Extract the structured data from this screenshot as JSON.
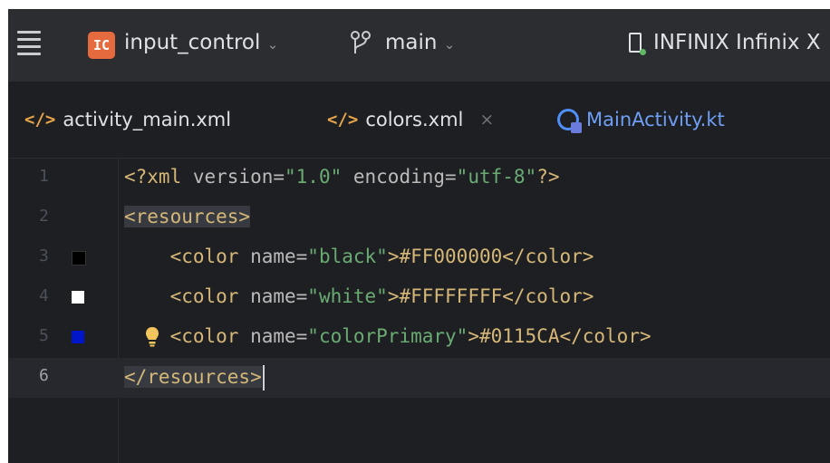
{
  "toolbar": {
    "project_badge": "IC",
    "project_name": "input_control",
    "branch_name": "main",
    "device_name": "INFINIX Infinix X",
    "chevron": "⌄"
  },
  "tabs": [
    {
      "label": "activity_main.xml",
      "icon": "xml-icon",
      "active": false
    },
    {
      "label": "colors.xml",
      "icon": "xml-icon",
      "active": true,
      "close": "×"
    },
    {
      "label": "MainActivity.kt",
      "icon": "kotlin-class-icon",
      "active": false
    }
  ],
  "xml_icon_glyph": "</>",
  "editor": {
    "lines": [
      {
        "num": "1",
        "parts": [
          "<?xml",
          " version=",
          "\"1.0\"",
          " encoding=",
          "\"utf-8\"",
          "?>"
        ]
      },
      {
        "num": "2",
        "parts": [
          "<resources>"
        ]
      },
      {
        "num": "3",
        "swatch": "#000000",
        "parts": [
          "<color",
          " name=",
          "\"black\"",
          ">#FF000000</",
          "color",
          ">"
        ]
      },
      {
        "num": "4",
        "swatch": "#FFFFFF",
        "parts": [
          "<color",
          " name=",
          "\"white\"",
          ">#FFFFFFFF</",
          "color",
          ">"
        ]
      },
      {
        "num": "5",
        "swatch": "#0115CA",
        "parts": [
          "<color",
          " name=",
          "\"colorPrimary\"",
          ">#0115CA</",
          "color",
          ">"
        ]
      },
      {
        "num": "6",
        "parts": [
          "</resources>"
        ]
      }
    ]
  },
  "colors": {
    "accent": "#3574f0",
    "toolbar_bg": "#2b2d30",
    "editor_bg": "#1e1f22",
    "string": "#6aab73",
    "tag": "#d5b778"
  }
}
